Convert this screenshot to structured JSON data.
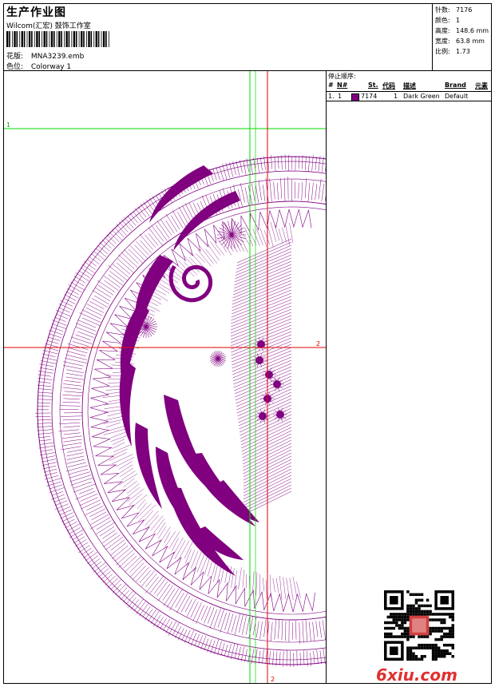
{
  "header": {
    "title": "生产作业图",
    "studio": "Wilcom(汇宏) 鼓饰工作室",
    "design_label": "花版:",
    "design_value": "MNA3239.emb",
    "colorway_label": "色位:",
    "colorway_value": "Colorway 1"
  },
  "stats": [
    {
      "label": "针数:",
      "value": "7176"
    },
    {
      "label": "颜色:",
      "value": "1"
    },
    {
      "label": "高度:",
      "value": "148.6 mm"
    },
    {
      "label": "宽度:",
      "value": "63.8 mm"
    },
    {
      "label": "比例:",
      "value": "1.73"
    }
  ],
  "stop_sequence": {
    "title": "停止顺序:",
    "columns": [
      "#",
      "N#",
      "St.",
      "代码",
      "描述",
      "Brand",
      "元素"
    ],
    "rows": [
      {
        "index": "1.",
        "n": "1",
        "stitches": "7174",
        "code": "1",
        "description": "Dark Green",
        "brand": "Default",
        "color": "#800080"
      }
    ]
  },
  "guides": {
    "h_label": "1",
    "v_label": "2",
    "h2_label": "2",
    "v_bottom_label": "2"
  },
  "colors": {
    "thread": "#800080",
    "guide_green": "#00dd00",
    "guide_red": "#e00000"
  },
  "watermark": "6xiu.com"
}
